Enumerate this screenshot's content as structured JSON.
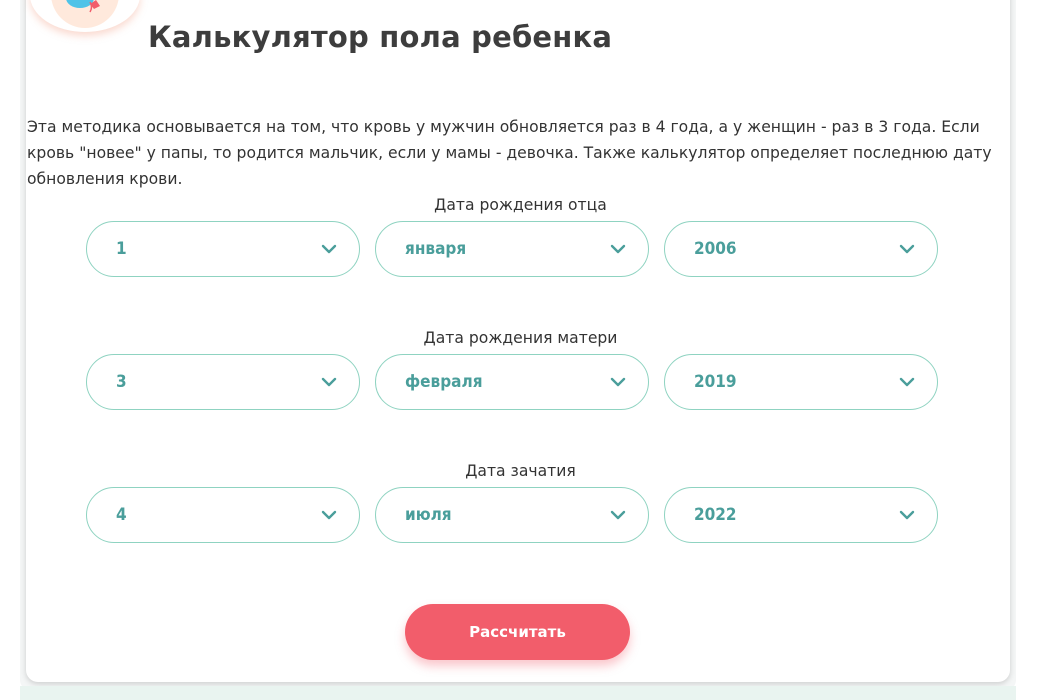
{
  "title": "Калькулятор пола ребенка",
  "description": "Эта методика основывается на том, что кровь у мужчин обновляется раз в 4 года, а у женщин - раз в 3 года. Если кровь \"новее\" у папы, то родится мальчик, если у мамы - девочка. Также калькулятор определяет последнюю дату обновления крови.",
  "father": {
    "label": "Дата рождения отца",
    "day": "1",
    "month": "января",
    "year": "2006"
  },
  "mother": {
    "label": "Дата рождения матери",
    "day": "3",
    "month": "февраля",
    "year": "2019"
  },
  "conception": {
    "label": "Дата зачатия",
    "day": "4",
    "month": "июля",
    "year": "2022"
  },
  "button": {
    "label": "Рассчитать"
  },
  "colors": {
    "accent": "#4a9e9b",
    "field_border": "#8fd3c1",
    "button": "#f25d6b",
    "title": "#3d3d3d"
  },
  "icons": {
    "select_arrow": "chevron-down-icon",
    "logo": "balloon-logo-icon"
  }
}
